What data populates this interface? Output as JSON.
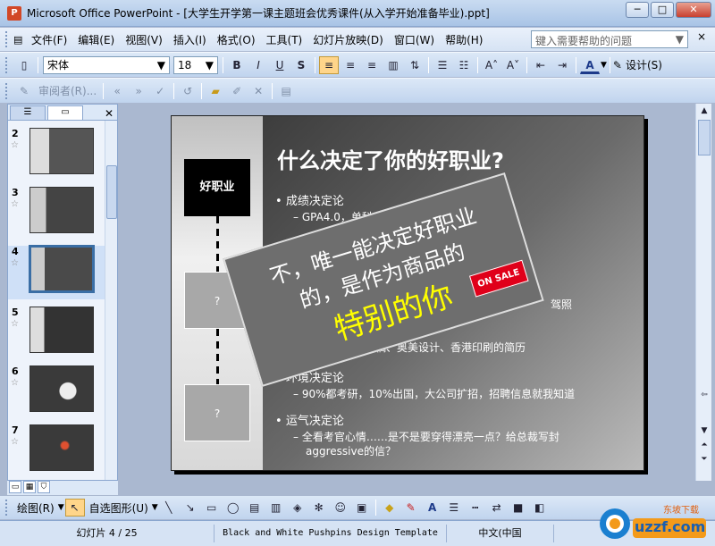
{
  "window": {
    "app_icon": "P",
    "title": "Microsoft Office PowerPoint - [大学生开学第一课主题班会优秀课件(从入学开始准备毕业).ppt]",
    "minimize": "─",
    "maximize": "□",
    "close": "✕"
  },
  "menu": {
    "items": [
      "文件(F)",
      "编辑(E)",
      "视图(V)",
      "插入(I)",
      "格式(O)",
      "工具(T)",
      "幻灯片放映(D)",
      "窗口(W)",
      "帮助(H)"
    ],
    "help_placeholder": "键入需要帮助的问题",
    "help_close": "×"
  },
  "toolbar1": {
    "font": "宋体",
    "size": "18",
    "bold": "B",
    "italic": "I",
    "underline": "U",
    "shadow": "S",
    "design": "设计(S)",
    "font_color_letter": "A"
  },
  "toolbar2": {
    "reviewer": "审阅者(R)..."
  },
  "outline": {
    "slides": [
      {
        "num": "2"
      },
      {
        "num": "3"
      },
      {
        "num": "4"
      },
      {
        "num": "5"
      },
      {
        "num": "6"
      },
      {
        "num": "7"
      }
    ],
    "selected": "4"
  },
  "slide": {
    "title": "什么决定了你的好职业?",
    "job_box": "好职业",
    "q1": "?",
    "q2": "?",
    "bullets": [
      {
        "level": 1,
        "text": "成绩决定论"
      },
      {
        "level": 2,
        "text": "GPA4.0，单科今"
      },
      {
        "level": 2,
        "text": "驾照"
      },
      {
        "level": 2,
        "text": "文稿、奥美设计、香港印刷的简历"
      },
      {
        "level": 1,
        "text": "环境决定论"
      },
      {
        "level": 2,
        "text": "90%都考研，10%出国，大公司扩招，招聘信息就我知道"
      },
      {
        "level": 1,
        "text": "运气决定论"
      },
      {
        "level": 2,
        "text": "全看考官心情……是不是要穿得漂亮一点？给总裁写封"
      },
      {
        "level": 2,
        "text": "aggressive的信？"
      }
    ],
    "stamp_line1": "不，唯一能决定好职业",
    "stamp_line2": "的，是作为商品的",
    "stamp_big": "特别的你",
    "onsale": "ON SALE"
  },
  "drawbar": {
    "draw": "绘图(R)",
    "autoshape": "自选图形(U)",
    "font_letter": "A"
  },
  "status": {
    "slide": "幻灯片 4 / 25",
    "template": "Black and White Pushpins Design Template",
    "language": "中文(中国"
  },
  "logo": {
    "text": "uzzf.com",
    "sub": "东坡下载"
  }
}
